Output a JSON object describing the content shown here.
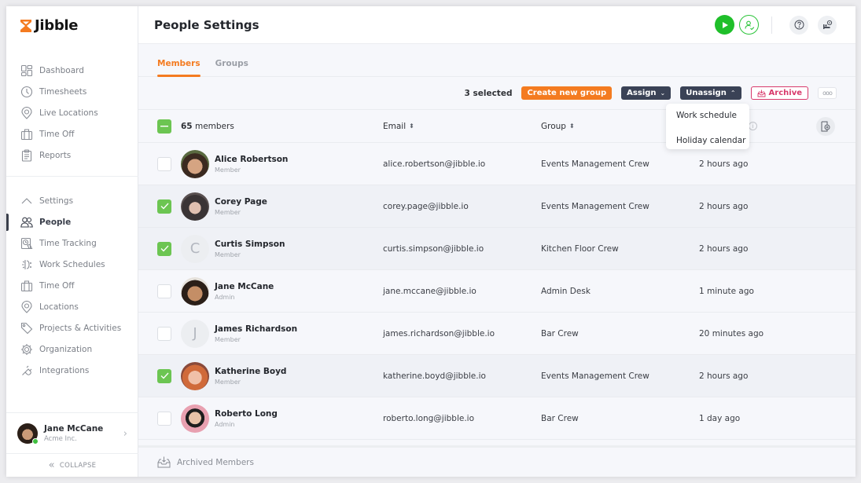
{
  "app": {
    "brand": "Jibble",
    "brand_color": "#f47b20"
  },
  "sidebar": {
    "main_items": [
      {
        "label": "Dashboard",
        "icon": "dashboard-icon"
      },
      {
        "label": "Timesheets",
        "icon": "clock-icon"
      },
      {
        "label": "Live Locations",
        "icon": "map-pin-icon"
      },
      {
        "label": "Time Off",
        "icon": "suitcase-icon"
      },
      {
        "label": "Reports",
        "icon": "clipboard-icon"
      }
    ],
    "settings_label": "Settings",
    "settings_items": [
      {
        "label": "People",
        "icon": "people-icon",
        "active": true
      },
      {
        "label": "Time Tracking",
        "icon": "time-tracking-icon"
      },
      {
        "label": "Work Schedules",
        "icon": "work-schedule-icon"
      },
      {
        "label": "Time Off",
        "icon": "suitcase-icon"
      },
      {
        "label": "Locations",
        "icon": "map-pin-icon"
      },
      {
        "label": "Projects & Activities",
        "icon": "tag-icon"
      },
      {
        "label": "Organization",
        "icon": "gear-icon"
      },
      {
        "label": "Integrations",
        "icon": "plug-icon"
      }
    ],
    "user": {
      "name": "Jane McCane",
      "org": "Acme Inc.",
      "status": "online"
    },
    "collapse_label": "COLLAPSE"
  },
  "header": {
    "title": "People Settings",
    "icons": [
      "play-icon",
      "clock-in-icon",
      "help-icon",
      "profile-settings-icon"
    ]
  },
  "tabs": [
    {
      "label": "Members",
      "active": true
    },
    {
      "label": "Groups",
      "active": false
    }
  ],
  "actions": {
    "selected_count": "3 selected",
    "create_group": "Create new group",
    "assign": "Assign",
    "unassign": "Unassign",
    "archive": "Archive",
    "more": "ooo"
  },
  "dropdown": {
    "items": [
      "Work schedule",
      "Holiday calendar"
    ]
  },
  "table": {
    "members_count": "65",
    "members_suffix": " members",
    "columns": {
      "email": "Email",
      "group": "Group",
      "last_active": ""
    },
    "rows": [
      {
        "name": "Alice Robertson",
        "role": "Member",
        "email": "alice.robertson@jibble.io",
        "group": "Events Management Crew",
        "last": "2 hours ago",
        "checked": false,
        "avatar": "photo-1",
        "initial": ""
      },
      {
        "name": "Corey Page",
        "role": "Member",
        "email": "corey.page@jibble.io",
        "group": "Events Management Crew",
        "last": "2 hours ago",
        "checked": true,
        "avatar": "photo-2",
        "initial": ""
      },
      {
        "name": "Curtis Simpson",
        "role": "Member",
        "email": "curtis.simpson@jibble.io",
        "group": "Kitchen Floor Crew",
        "last": "2 hours ago",
        "checked": true,
        "avatar": "initial",
        "initial": "C"
      },
      {
        "name": "Jane McCane",
        "role": "Admin",
        "email": "jane.mccane@jibble.io",
        "group": "Admin Desk",
        "last": "1 minute ago",
        "checked": false,
        "avatar": "photo-3",
        "initial": ""
      },
      {
        "name": "James Richardson",
        "role": "Member",
        "email": "james.richardson@jibble.io",
        "group": "Bar Crew",
        "last": "20 minutes ago",
        "checked": false,
        "avatar": "initial",
        "initial": "J"
      },
      {
        "name": "Katherine Boyd",
        "role": "Member",
        "email": "katherine.boyd@jibble.io",
        "group": "Events Management Crew",
        "last": "2 hours ago",
        "checked": true,
        "avatar": "photo-4",
        "initial": ""
      },
      {
        "name": "Roberto Long",
        "role": "Admin",
        "email": "roberto.long@jibble.io",
        "group": "Bar Crew",
        "last": "1 day ago",
        "checked": false,
        "avatar": "photo-5",
        "initial": ""
      }
    ]
  },
  "footer": {
    "archived_label": "Archived Members"
  }
}
